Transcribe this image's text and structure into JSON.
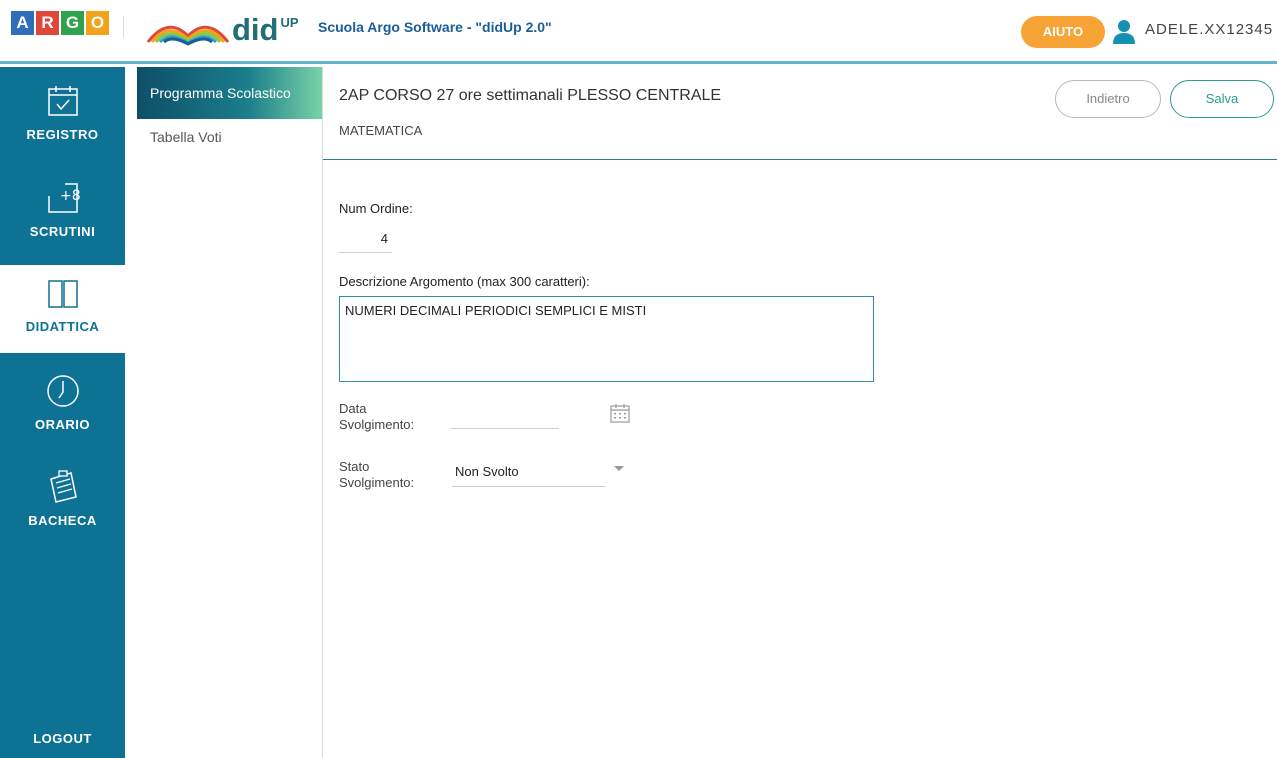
{
  "brand": {
    "argo_letters": [
      "A",
      "R",
      "G",
      "O"
    ],
    "argo_colors": [
      "#2f6eb8",
      "#e1463b",
      "#2fa34b",
      "#f2a31a"
    ],
    "didup_name": "did",
    "didup_sup": "UP",
    "school": "Scuola Argo Software - \"didUp 2.0\""
  },
  "header": {
    "help_label": "AIUTO",
    "user_name": "ADELE.XX12345"
  },
  "sidebar": {
    "items": [
      {
        "label": "REGISTRO",
        "icon": "calendar-check-icon"
      },
      {
        "label": "SCRUTINI",
        "icon": "grades-icon"
      },
      {
        "label": "DIDATTICA",
        "icon": "book-icon"
      },
      {
        "label": "ORARIO",
        "icon": "clock-icon"
      },
      {
        "label": "BACHECA",
        "icon": "board-icon"
      }
    ],
    "logout_label": "LOGOUT"
  },
  "submenu": {
    "items": [
      {
        "label": "Programma Scolastico"
      },
      {
        "label": "Tabella Voti"
      }
    ]
  },
  "main": {
    "class_title": "2AP CORSO 27 ore settimanali PLESSO CENTRALE",
    "subject": "MATEMATICA",
    "back_label": "Indietro",
    "save_label": "Salva"
  },
  "form": {
    "num_label": "Num Ordine:",
    "num_value": "4",
    "desc_label": "Descrizione Argomento (max 300 caratteri):",
    "desc_value": "NUMERI DECIMALI PERIODICI SEMPLICI E MISTI",
    "date_label_1": "Data",
    "date_label_2": "Svolgimento:",
    "date_value": "",
    "state_label_1": "Stato",
    "state_label_2": "Svolgimento:",
    "state_value": "Non Svolto"
  },
  "colors": {
    "sidebar": "#0d7294",
    "help": "#f7a336",
    "save": "#2a9e8e",
    "accent": "#2e8fa6"
  }
}
